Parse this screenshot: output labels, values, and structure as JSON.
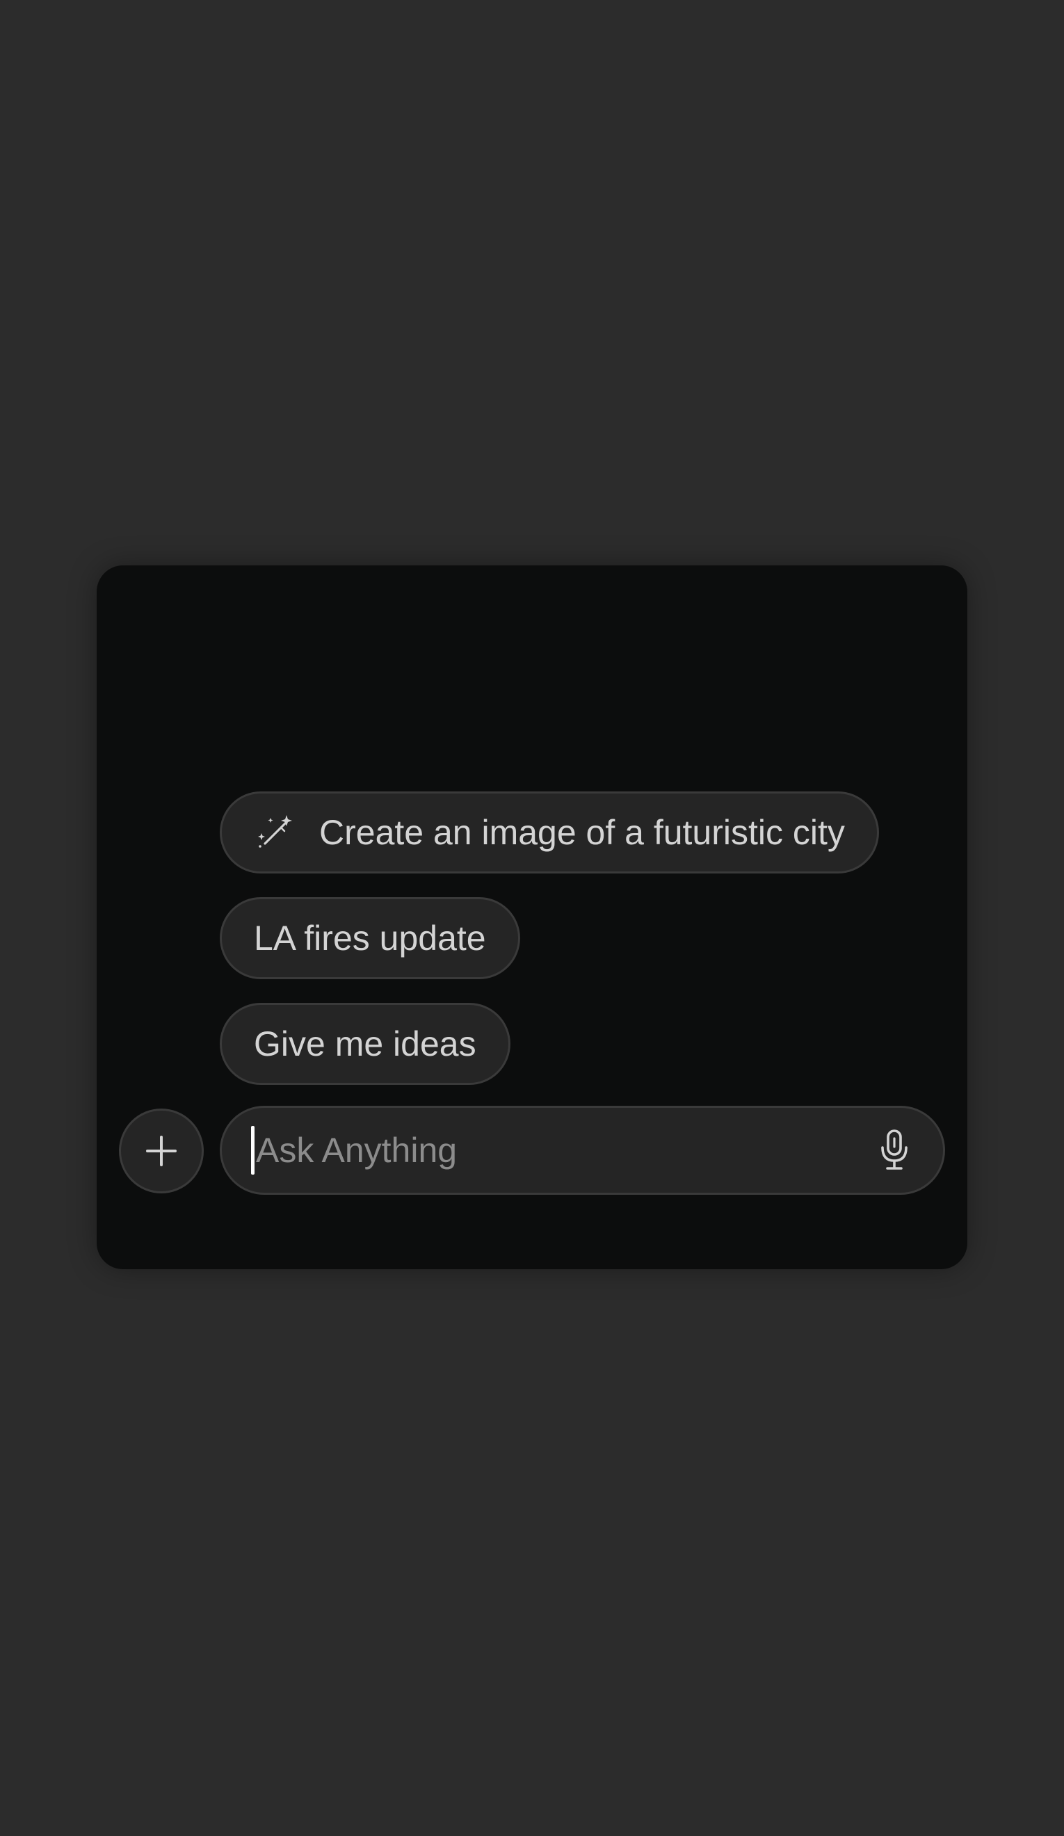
{
  "suggestions": [
    {
      "label": "Create an image of a futuristic city",
      "icon": "magic-wand-icon"
    },
    {
      "label": "LA fires update"
    },
    {
      "label": "Give me ideas"
    }
  ],
  "composer": {
    "add_icon": "plus-icon",
    "placeholder": "Ask Anything",
    "value": "",
    "mic_icon": "microphone-icon"
  },
  "colors": {
    "page_background": "#2c2c2c",
    "panel_background": "#0c0d0d",
    "pill_background": "#252525",
    "pill_border": "#3a3a3a",
    "text": "#d4d4d4",
    "placeholder": "#8c8c8c"
  }
}
